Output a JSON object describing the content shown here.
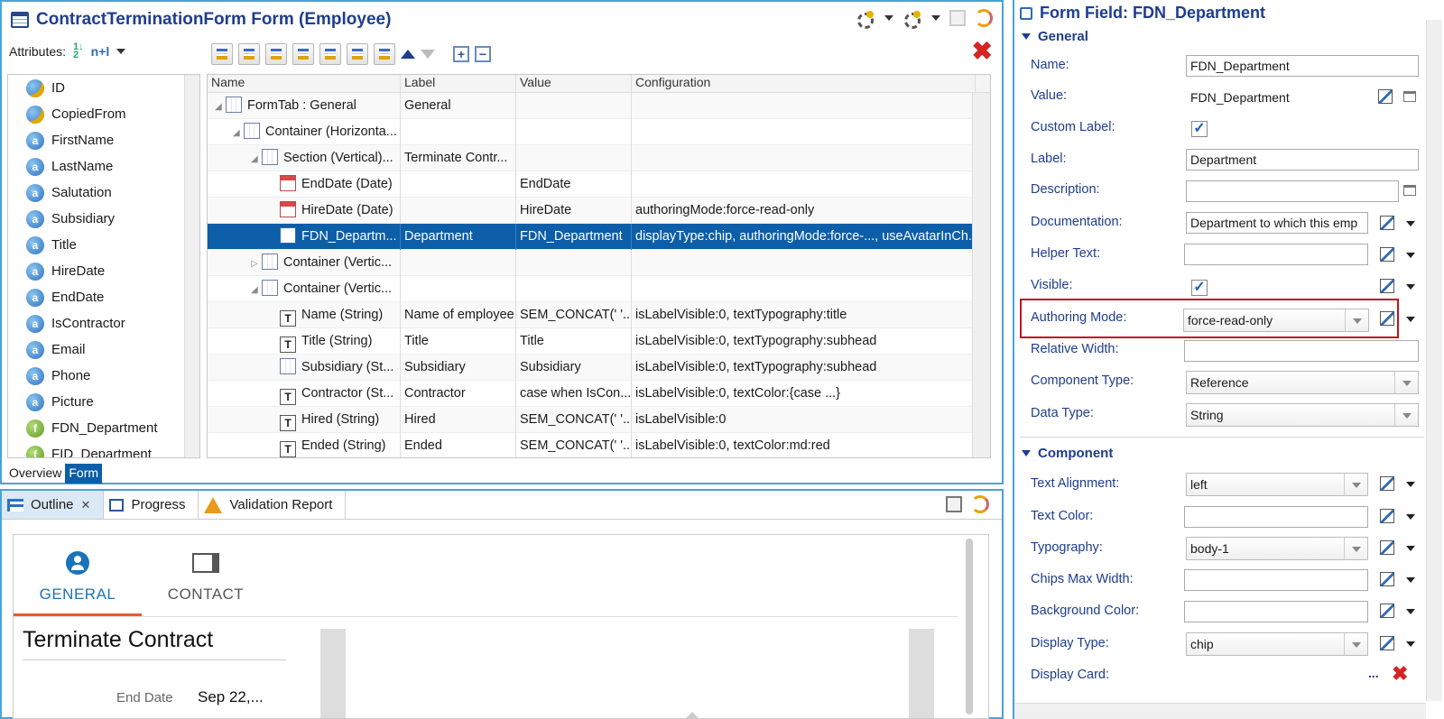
{
  "editor": {
    "title": "ContractTerminationForm Form (Employee)",
    "attributes_label": "Attributes:",
    "sort_label": "n+l",
    "attributes": [
      {
        "name": "ID",
        "icon": "key-attribute-icon"
      },
      {
        "name": "CopiedFrom",
        "icon": "key-attribute-icon"
      },
      {
        "name": "FirstName",
        "icon": "attribute-icon"
      },
      {
        "name": "LastName",
        "icon": "attribute-icon"
      },
      {
        "name": "Salutation",
        "icon": "attribute-icon"
      },
      {
        "name": "Subsidiary",
        "icon": "attribute-icon"
      },
      {
        "name": "Title",
        "icon": "attribute-icon"
      },
      {
        "name": "HireDate",
        "icon": "attribute-icon"
      },
      {
        "name": "EndDate",
        "icon": "attribute-icon"
      },
      {
        "name": "IsContractor",
        "icon": "attribute-icon"
      },
      {
        "name": "Email",
        "icon": "attribute-icon"
      },
      {
        "name": "Phone",
        "icon": "attribute-icon"
      },
      {
        "name": "Picture",
        "icon": "attribute-icon"
      },
      {
        "name": "FDN_Department",
        "icon": "function-attribute-icon"
      },
      {
        "name": "FID_Department",
        "icon": "function-attribute-icon"
      }
    ],
    "tree_columns": [
      "Name",
      "Label",
      "Value",
      "Configuration"
    ],
    "tree_rows": [
      {
        "name": "FormTab : General",
        "label": "General",
        "value": "",
        "config": ""
      },
      {
        "name": "Container (Horizonta...",
        "label": "",
        "value": "",
        "config": ""
      },
      {
        "name": "Section (Vertical)...",
        "label": "Terminate Contr...",
        "value": "",
        "config": ""
      },
      {
        "name": "EndDate (Date)",
        "label": "",
        "value": "EndDate",
        "config": ""
      },
      {
        "name": "HireDate (Date)",
        "label": "",
        "value": "HireDate",
        "config": "authoringMode:force-read-only"
      },
      {
        "name": "FDN_Departm...",
        "label": "Department",
        "value": "FDN_Department",
        "config": "displayType:chip, authoringMode:force-..., useAvatarInCh..."
      },
      {
        "name": "Container (Vertic...",
        "label": "",
        "value": "",
        "config": ""
      },
      {
        "name": "Container (Vertic...",
        "label": "",
        "value": "",
        "config": ""
      },
      {
        "name": "Name (String)",
        "label": "Name of employee",
        "value": "SEM_CONCAT(' '...",
        "config": "isLabelVisible:0, textTypography:title"
      },
      {
        "name": "Title (String)",
        "label": "Title",
        "value": "Title",
        "config": "isLabelVisible:0, textTypography:subhead"
      },
      {
        "name": "Subsidiary (St...",
        "label": "Subsidiary",
        "value": "Subsidiary",
        "config": "isLabelVisible:0, textTypography:subhead"
      },
      {
        "name": "Contractor (St...",
        "label": "Contractor",
        "value": "case when IsCon...",
        "config": "isLabelVisible:0, textColor:{case ...}"
      },
      {
        "name": "Hired (String)",
        "label": "Hired",
        "value": "SEM_CONCAT(' '...",
        "config": "isLabelVisible:0"
      },
      {
        "name": "Ended (String)",
        "label": "Ended",
        "value": "SEM_CONCAT(' '...",
        "config": "isLabelVisible:0, textColor:md:red"
      }
    ],
    "bottom_tabs": [
      "Overview",
      "Form"
    ]
  },
  "outline": {
    "tabs": [
      "Outline",
      "Progress",
      "Validation Report"
    ],
    "preview": {
      "tab1": "GENERAL",
      "tab2": "CONTACT",
      "section_title": "Terminate Contract",
      "field_label": "End Date",
      "field_value": "Sep 22,..."
    }
  },
  "props": {
    "title": "Form Field: FDN_Department",
    "general_header": "General",
    "component_header": "Component",
    "name_label": "Name:",
    "name_value": "FDN_Department",
    "value_label": "Value:",
    "value_value": "FDN_Department",
    "custom_label_label": "Custom Label:",
    "label_label": "Label:",
    "label_value": "Department",
    "description_label": "Description:",
    "documentation_label": "Documentation:",
    "documentation_value": "Department to which this emp",
    "helper_text_label": "Helper Text:",
    "visible_label": "Visible:",
    "authoring_mode_label": "Authoring Mode:",
    "authoring_mode_value": "force-read-only",
    "relative_width_label": "Relative Width:",
    "component_type_label": "Component Type:",
    "component_type_value": "Reference",
    "data_type_label": "Data Type:",
    "data_type_value": "String",
    "text_alignment_label": "Text Alignment:",
    "text_alignment_value": "left",
    "text_color_label": "Text Color:",
    "typography_label": "Typography:",
    "typography_value": "body-1",
    "chips_max_width_label": "Chips Max Width:",
    "background_color_label": "Background Color:",
    "display_type_label": "Display Type:",
    "display_type_value": "chip",
    "display_card_label": "Display Card:",
    "display_card_more": "...",
    "check_mark": "✓"
  },
  "colors": {
    "accent": "#1e3d8f",
    "selection": "#0c5ea8",
    "highlight": "#c0151b",
    "frame": "#4aa3d6"
  }
}
